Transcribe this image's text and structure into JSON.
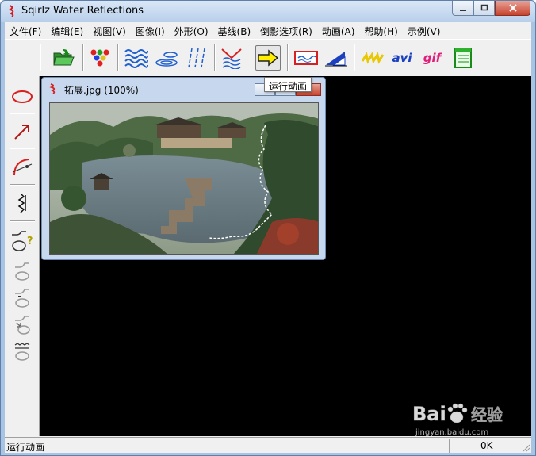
{
  "window": {
    "title": "Sqirlz Water Reflections"
  },
  "menu": [
    "文件(F)",
    "编辑(E)",
    "视图(V)",
    "图像(I)",
    "外形(O)",
    "基线(B)",
    "倒影选项(R)",
    "动画(A)",
    "帮助(H)",
    "示例(V)"
  ],
  "toolbar": {
    "buttons": [
      {
        "name": "open-folder-icon"
      },
      {
        "name": "color-dots-icon"
      },
      {
        "name": "waves-icon"
      },
      {
        "name": "ripples-icon"
      },
      {
        "name": "rain-icon"
      },
      {
        "name": "stream-icon"
      },
      {
        "name": "arrow-right-icon"
      },
      {
        "name": "preview-frame-icon"
      },
      {
        "name": "triangle-icon"
      },
      {
        "name": "zigzag-icon"
      },
      {
        "name": "avi-label",
        "text": "avi"
      },
      {
        "name": "gif-label",
        "text": "gif"
      },
      {
        "name": "document-icon"
      }
    ],
    "tooltip": "运行动画"
  },
  "left_tools": [
    "ellipse-icon",
    "arrow-icon",
    "curve-icon",
    "baseline-icon",
    "reflection-help-icon",
    "reflection-1-icon",
    "reflection-2-icon",
    "reflection-3-icon",
    "reflection-4-icon"
  ],
  "document_window": {
    "title": "拓展.jpg   (100%)"
  },
  "statusbar": {
    "left_text": "运行动画",
    "right_text": "0K"
  },
  "watermark": {
    "logo_text": "Bai",
    "logo_text2": "经验",
    "subtext": "jingyan.baidu.com"
  },
  "colors": {
    "canvas_bg": "#000000",
    "accent_blue": "#1a5fd0",
    "accent_red": "#d8141c"
  }
}
